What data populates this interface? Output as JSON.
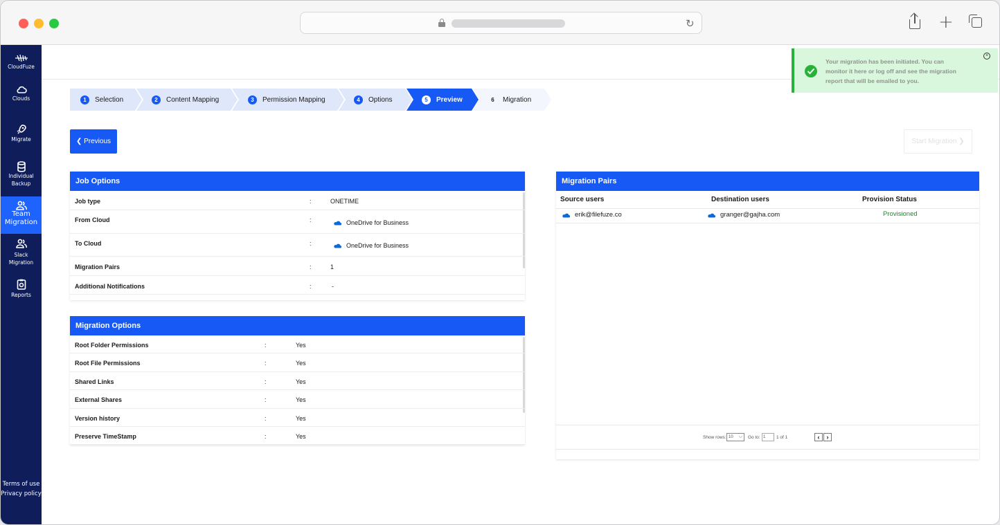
{
  "sidebar": {
    "logo_label": "CloudFuze",
    "items": [
      {
        "label": "Clouds",
        "icon": "cloud-icon"
      },
      {
        "label": "Migrate",
        "icon": "rocket-icon"
      },
      {
        "label": "Individual Backup",
        "icon": "database-icon"
      },
      {
        "label": "Team Migration",
        "icon": "users-icon"
      },
      {
        "label": "Slack Migration",
        "icon": "users-icon"
      },
      {
        "label": "Reports",
        "icon": "report-icon"
      }
    ],
    "footer": {
      "terms": "Terms of use",
      "privacy": "Privacy policy"
    }
  },
  "stepper": [
    {
      "num": "1",
      "label": "Selection"
    },
    {
      "num": "2",
      "label": "Content Mapping"
    },
    {
      "num": "3",
      "label": "Permission Mapping"
    },
    {
      "num": "4",
      "label": "Options"
    },
    {
      "num": "5",
      "label": "Preview"
    },
    {
      "num": "6",
      "label": "Migration"
    }
  ],
  "buttons": {
    "previous": "❮ Previous",
    "start": "Start Migration ❯"
  },
  "job_options": {
    "title": "Job Options",
    "rows": [
      {
        "key": "Job type",
        "value": "ONETIME"
      },
      {
        "key": "From Cloud",
        "value": "OneDrive for Business"
      },
      {
        "key": "To Cloud",
        "value": "OneDrive for Business"
      },
      {
        "key": "Migration Pairs",
        "value": "1"
      },
      {
        "key": "Additional Notifications",
        "value": "-"
      }
    ]
  },
  "migration_options": {
    "title": "Migration Options",
    "rows": [
      {
        "key": "Root Folder Permissions",
        "value": "Yes"
      },
      {
        "key": "Root File Permissions",
        "value": "Yes"
      },
      {
        "key": "Shared Links",
        "value": "Yes"
      },
      {
        "key": "External Shares",
        "value": "Yes"
      },
      {
        "key": "Version history",
        "value": "Yes"
      },
      {
        "key": "Preserve TimeStamp",
        "value": "Yes"
      }
    ]
  },
  "migration_pairs": {
    "title": "Migration Pairs",
    "columns": [
      "Source users",
      "Destination users",
      "Provision Status"
    ],
    "rows": [
      {
        "source": "erik@filefuze.co",
        "destination": "granger@gajha.com",
        "status": "Provisioned"
      }
    ],
    "pager": {
      "show_rows_label": "Show rows:",
      "rows_value": "10",
      "goto_label": "Go to:",
      "goto_value": "1",
      "page_info": "1 of 1"
    }
  },
  "toast": {
    "message": "Your migration has been initiated. You can monitor it here or log off and see the migration report that will be emailed to you."
  },
  "colors": {
    "primary": "#1659f5",
    "sidebar": "#0f1e5a",
    "success": "#28b23a",
    "provisioned": "#1f8a2e"
  }
}
